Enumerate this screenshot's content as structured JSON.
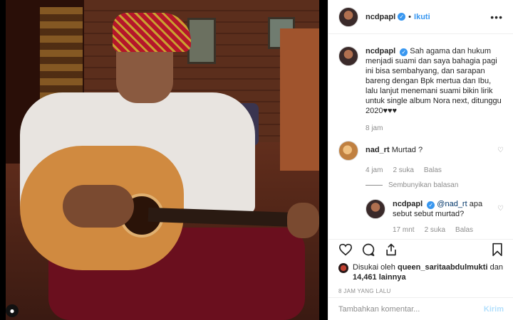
{
  "post": {
    "username": "ncdpapl",
    "follow_label": "Ikuti",
    "separator": "•",
    "more_icon": "more-horizontal-icon"
  },
  "caption": {
    "username": "ncdpapl",
    "text": "Sah agama dan hukum menjadi suami dan saya bahagia pagi ini bisa sembahyang, dan sarapan bareng dengan Bpk mertua dan Ibu, lalu lanjut menemani suami bikin lirik untuk single album Nora next, ditunggu 2020♥♥♥",
    "time": "8 jam"
  },
  "comments": [
    {
      "username": "nad_rt",
      "text": "Murtad ?",
      "time": "4 jam",
      "likes": "2 suka",
      "reply_label": "Balas"
    }
  ],
  "hide_replies_label": "Sembunyikan balasan",
  "reply": {
    "username": "ncdpapl",
    "mention": "@nad_rt",
    "text": " apa sebut sebut murtad?",
    "time": "17 mnt",
    "likes": "2 suka",
    "reply_label": "Balas"
  },
  "likes": {
    "prefix": "Disukai oleh",
    "user": "queen_saritaabdulmukti",
    "and": "dan",
    "count": "14,461 lainnya"
  },
  "timestamp": "8 JAM YANG LALU",
  "comment_box": {
    "placeholder": "Tambahkan komentar...",
    "send_label": "Kirim"
  },
  "colors": {
    "accent": "#3897f0",
    "muted": "#8e8e8e",
    "text": "#262626"
  }
}
